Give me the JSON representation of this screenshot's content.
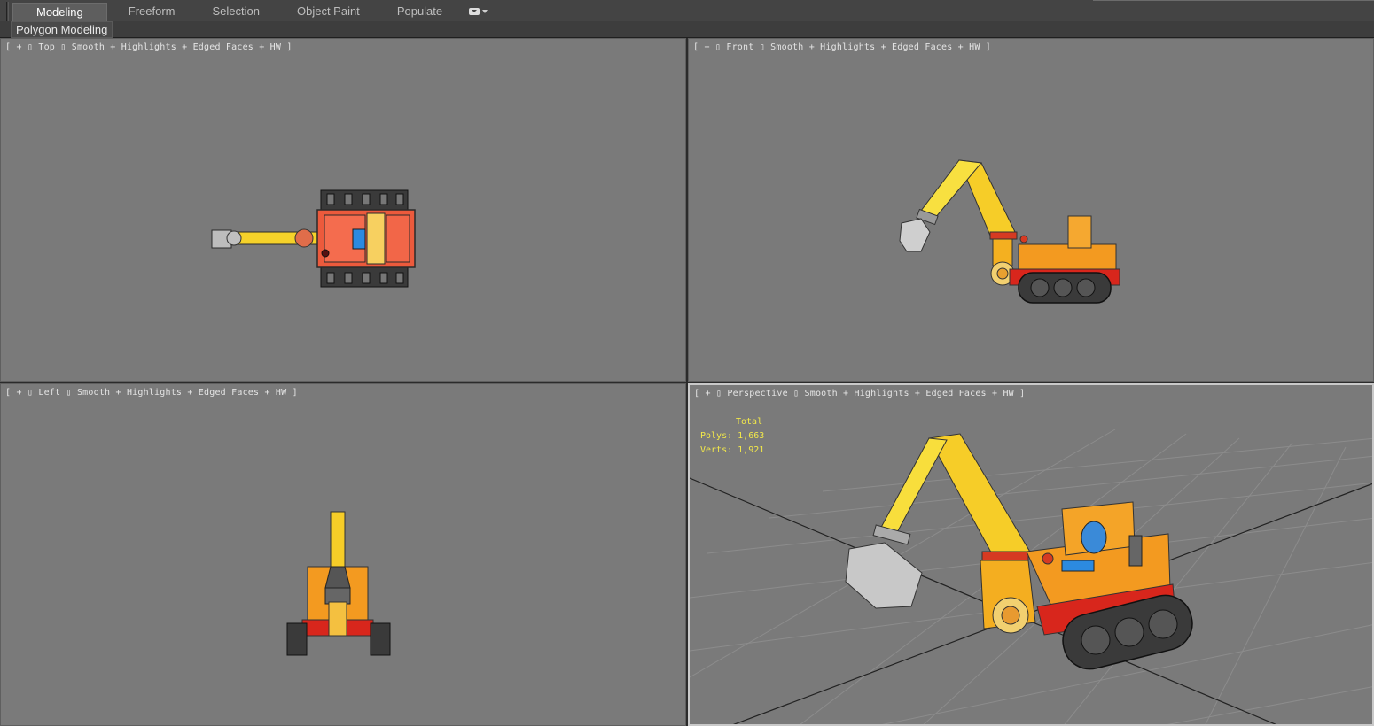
{
  "ribbon": {
    "tabs": [
      "Modeling",
      "Freeform",
      "Selection",
      "Object Paint",
      "Populate"
    ],
    "active_tab": "Modeling",
    "panel_label": "Polygon Modeling"
  },
  "viewports": {
    "top": {
      "plus": "[ + ]",
      "view": "Top",
      "shading": "Smooth + Highlights + Edged Faces + HW",
      "close": "]"
    },
    "front": {
      "plus": "[ + ]",
      "view": "Front",
      "shading": "Smooth + Highlights + Edged Faces + HW",
      "close": "]"
    },
    "left": {
      "plus": "[ + ]",
      "view": "Left",
      "shading": "Smooth + Highlights + Edged Faces + HW",
      "close": "]"
    },
    "perspective": {
      "plus": "[ + ]",
      "view": "Perspective",
      "shading": "Smooth + Highlights + Edged Faces + HW",
      "close": "]"
    }
  },
  "stats": {
    "header": "Total",
    "polys_label": "Polys:",
    "polys_value": "1,663",
    "verts_label": "Verts:",
    "verts_value": "1,921"
  },
  "colors": {
    "viewport_bg": "#7a7a7a",
    "body_yellow": "#f2b020",
    "arm_yellow": "#f7dc2e",
    "track_red": "#d92a1c",
    "track_black": "#333333",
    "stats_yellow": "#f2e84a"
  }
}
